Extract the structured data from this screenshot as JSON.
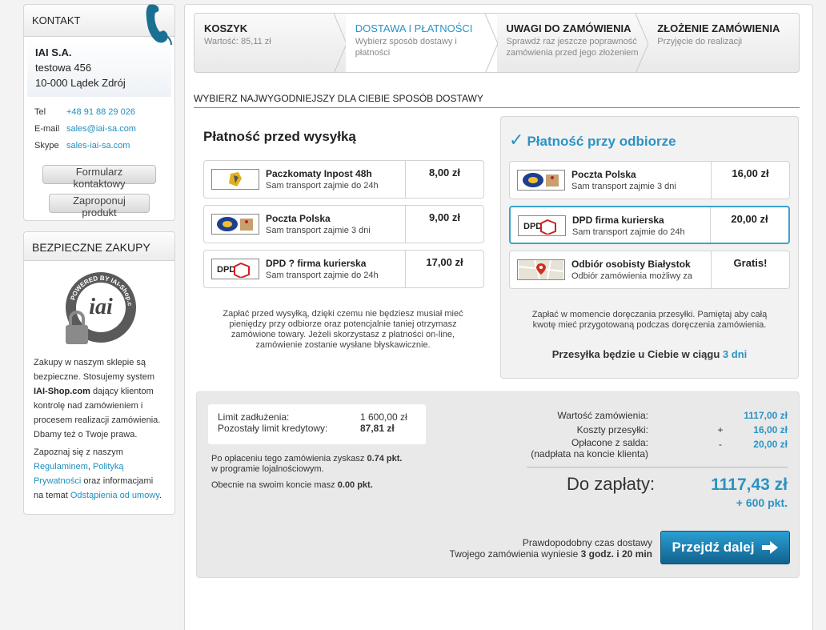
{
  "contact": {
    "title": "KONTAKT",
    "company": "IAI S.A.",
    "street": "testowa 456",
    "city": "10-000 Lądek Zdrój",
    "tel_label": "Tel",
    "tel": "+48 91 88 29 026",
    "email_label": "E-mail",
    "email": "sales@iai-sa.com",
    "skype_label": "Skype",
    "skype": "sales-iai-sa.com",
    "contact_form_button": "Formularz kontaktowy",
    "propose_button": "Zaproponuj produkt"
  },
  "secure": {
    "title": "BEZPIECZNE ZAKUPY",
    "seal_text": "POWERED BY IAI-Shop.com",
    "text1_a": "Zakupy w naszym sklepie są bezpieczne. Stosujemy system ",
    "text1_b": "IAI-Shop.com",
    "text1_c": " dający klientom kontrolę nad zamówieniem i procesem realizacji zamówienia. Dbamy też o Twoje prawa.",
    "text2_a": "Zapoznaj się z naszym ",
    "link_rules": "Regulaminem",
    "text2_b": ", ",
    "link_privacy": "Polityką Prywatności",
    "text2_c": " oraz informacjami na temat ",
    "link_withdrawal": "Odstąpienia od umowy",
    "text2_d": "."
  },
  "steps": [
    {
      "title": "KOSZYK",
      "sub": "Wartość: 85,11 zł"
    },
    {
      "title": "DOSTAWA I PŁATNOŚCI",
      "sub": "Wybierz sposób dostawy i płatności"
    },
    {
      "title": "UWAGI DO ZAMÓWIENIA",
      "sub": "Sprawdź raz jeszcze poprawność zamówienia przed jego złożeniem"
    },
    {
      "title": "ZŁOŻENIE ZAMÓWIENIA",
      "sub": "Przyjęcie do realizacji"
    }
  ],
  "section_title": "WYBIERZ NAJWYGODNIEJSZY DLA CIEBIE SPOSÓB DOSTAWY",
  "before": {
    "title": "Płatność przed wysyłką",
    "options": [
      {
        "name": "Paczkomaty Inpost 48h",
        "desc": "Sam transport zajmie do 24h",
        "price": "8,00 zł"
      },
      {
        "name": "Poczta Polska",
        "desc": "Sam transport zajmie 3 dni",
        "price": "9,00 zł"
      },
      {
        "name": "DPD ? firma kurierska",
        "desc": "Sam transport zajmie do 24h",
        "price": "17,00 zł"
      }
    ],
    "note": "Zapłać przed wysyłką, dzięki czemu nie będziesz musiał mieć pieniędzy przy odbiorze oraz potencjalnie taniej otrzymasz zamówione towary. Jeżeli skorzystasz z płatności on-line, zamówienie zostanie wysłane błyskawicznie."
  },
  "after": {
    "check": "✓",
    "title": "Płatność przy odbiorze",
    "options": [
      {
        "name": "Poczta Polska",
        "desc": "Sam transport zajmie 3 dni",
        "price": "16,00 zł"
      },
      {
        "name": "DPD firma kurierska",
        "desc": "Sam transport zajmie do 24h",
        "price": "20,00 zł"
      },
      {
        "name": "Odbiór osobisty Białystok",
        "desc": "Odbiór zamówienia możliwy za",
        "price": "Gratis!"
      }
    ],
    "note": "Zapłać w momencie doręczania przesyłki. Pamiętaj aby całą kwotę mieć przygotowaną podczas doręczenia zamówienia.",
    "eta_text": "Przesyłka będzie u Ciebie w ciągu",
    "eta_value": "3 dni"
  },
  "summary": {
    "credit_limit_label": "Limit zadłużenia:",
    "credit_limit_value": "1 600,00 zł",
    "credit_left_label": "Pozostały limit kredytowy:",
    "credit_left_value": "87,81 zł",
    "loyal_a": "Po opłaceniu tego zamówienia zyskasz ",
    "loyal_b": "0.74 pkt.",
    "loyal_c": "w programie lojalnościowym.",
    "account_a": "Obecnie na swoim koncie masz ",
    "account_b": "0.00 pkt.",
    "order_value_label": "Wartość zamówienia:",
    "order_value": "1117,00 zł",
    "shipping_label": "Koszty przesyłki:",
    "shipping_sign": "+",
    "shipping_value": "16,00 zł",
    "balance_label_1": "Opłacone z salda:",
    "balance_label_2": "(nadpłata na koncie klienta)",
    "balance_sign": "-",
    "balance_value": "20,00 zł",
    "to_pay_label": "Do zapłaty:",
    "to_pay_value": "1117,43 zł",
    "points": "+ 600 pkt.",
    "delivery_line1": "Prawdopodobny czas dostawy",
    "delivery_line2_a": "Twojego zamówienia wyniesie ",
    "delivery_line2_b": "3 godz. i 20 min",
    "proceed_button": "Przejdź dalej"
  }
}
